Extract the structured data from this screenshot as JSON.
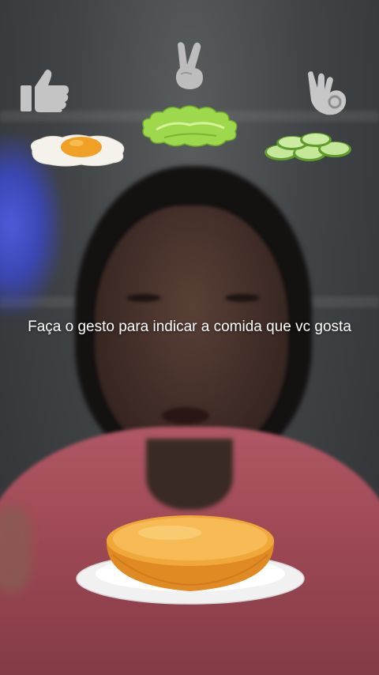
{
  "overlay": {
    "instruction_text": "Faça o gesto para indicar a comida que vc gosta"
  },
  "gestures": [
    {
      "icon": "thumbs-up-icon",
      "food": "fried-egg"
    },
    {
      "icon": "peace-sign-icon",
      "food": "lettuce"
    },
    {
      "icon": "ok-hand-icon",
      "food": "cucumber-slices"
    }
  ],
  "plate": {
    "item": "burger-bun-bottom",
    "dish": "white-plate"
  },
  "colors": {
    "icon_gray": "#bfbfbf",
    "shirt_pink": "#a24e5a",
    "bun_orange": "#e9962c",
    "text": "#ffffff"
  }
}
